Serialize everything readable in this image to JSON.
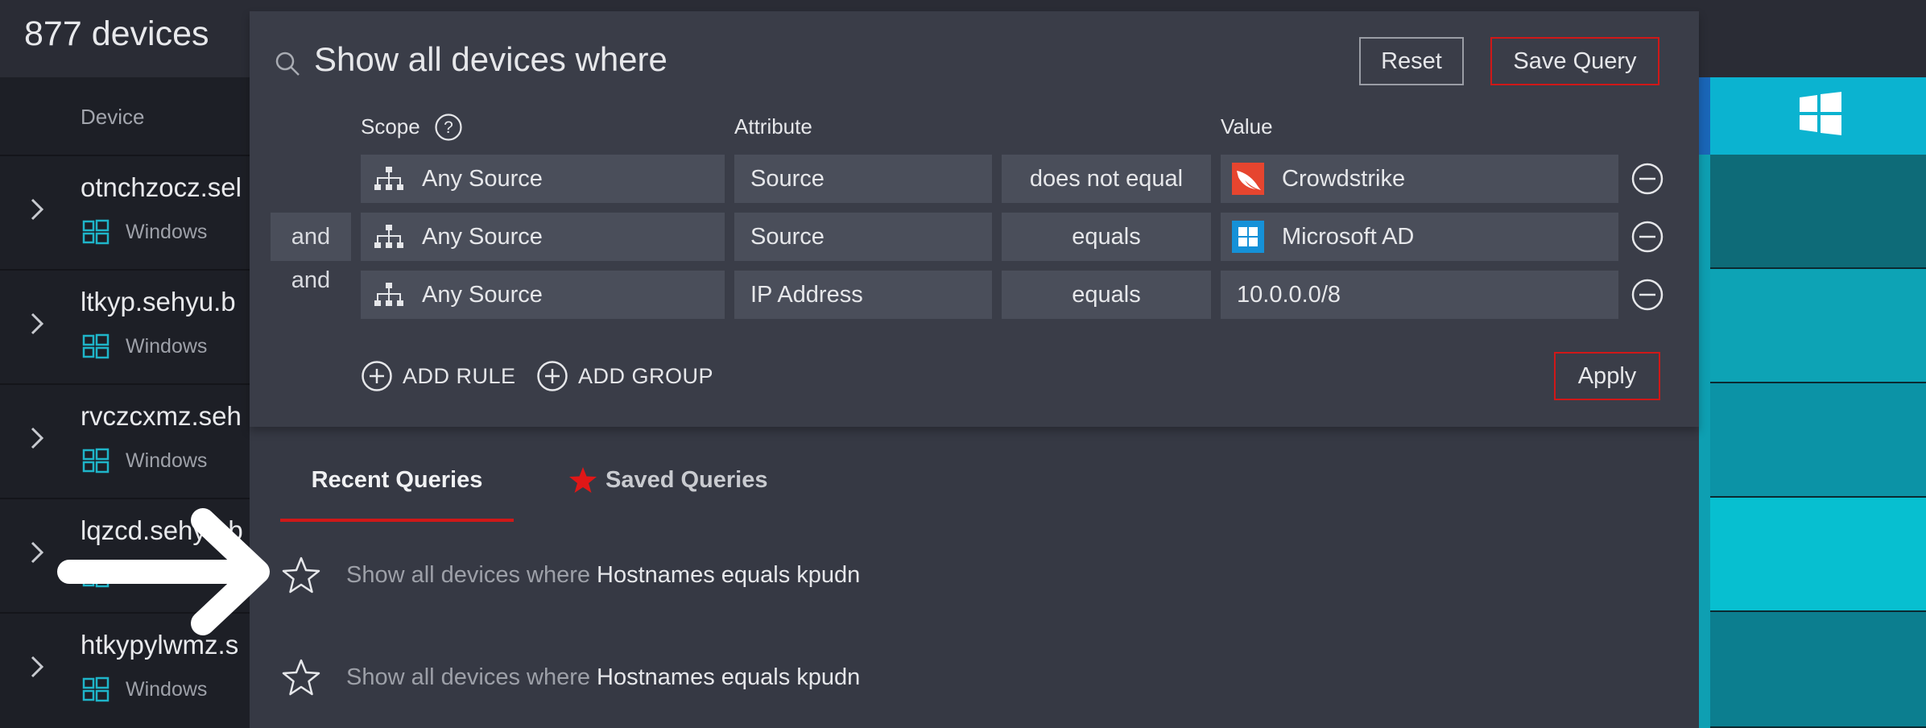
{
  "header": {
    "device_count": "877 devices"
  },
  "device_list": {
    "column_header": "Device",
    "rows": [
      {
        "name": "otnchzocz.sel",
        "os": "Windows"
      },
      {
        "name": "ltkyp.sehyu.b",
        "os": "Windows"
      },
      {
        "name": "rvczcxmz.seh",
        "os": "Windows"
      },
      {
        "name": "lqzcd.sehyu.b",
        "os": "Windows"
      },
      {
        "name": "htkypylwmz.s",
        "os": "Windows"
      }
    ]
  },
  "query": {
    "title": "Show all devices where",
    "reset_label": "Reset",
    "save_label": "Save Query",
    "apply_label": "Apply",
    "columns": {
      "scope": "Scope",
      "attribute": "Attribute",
      "value": "Value"
    },
    "rules": [
      {
        "conjunction": "",
        "scope": "Any Source",
        "attribute": "Source",
        "operator": "does not equal",
        "value": "Crowdstrike",
        "value_icon": "crowdstrike-icon"
      },
      {
        "conjunction": "and",
        "scope": "Any Source",
        "attribute": "Source",
        "operator": "equals",
        "value": "Microsoft AD",
        "value_icon": "microsoft-windows-icon"
      },
      {
        "conjunction": "and",
        "scope": "Any Source",
        "attribute": "IP Address",
        "operator": "equals",
        "value": "10.0.0.0/8",
        "value_icon": ""
      }
    ],
    "add_rule_label": "ADD RULE",
    "add_group_label": "ADD GROUP"
  },
  "tabs": {
    "recent": "Recent Queries",
    "saved": "Saved Queries",
    "active": "recent"
  },
  "recent_queries": [
    {
      "prefix": "Show all devices where",
      "condition": "Hostnames equals kpudn"
    },
    {
      "prefix": "Show all devices where",
      "condition": "Hostnames equals kpudn"
    }
  ],
  "colors": {
    "accent_red": "#d01818",
    "panel": "#3a3d48",
    "field": "#4a4e5a",
    "tile_teal": "#0bb3d0"
  }
}
